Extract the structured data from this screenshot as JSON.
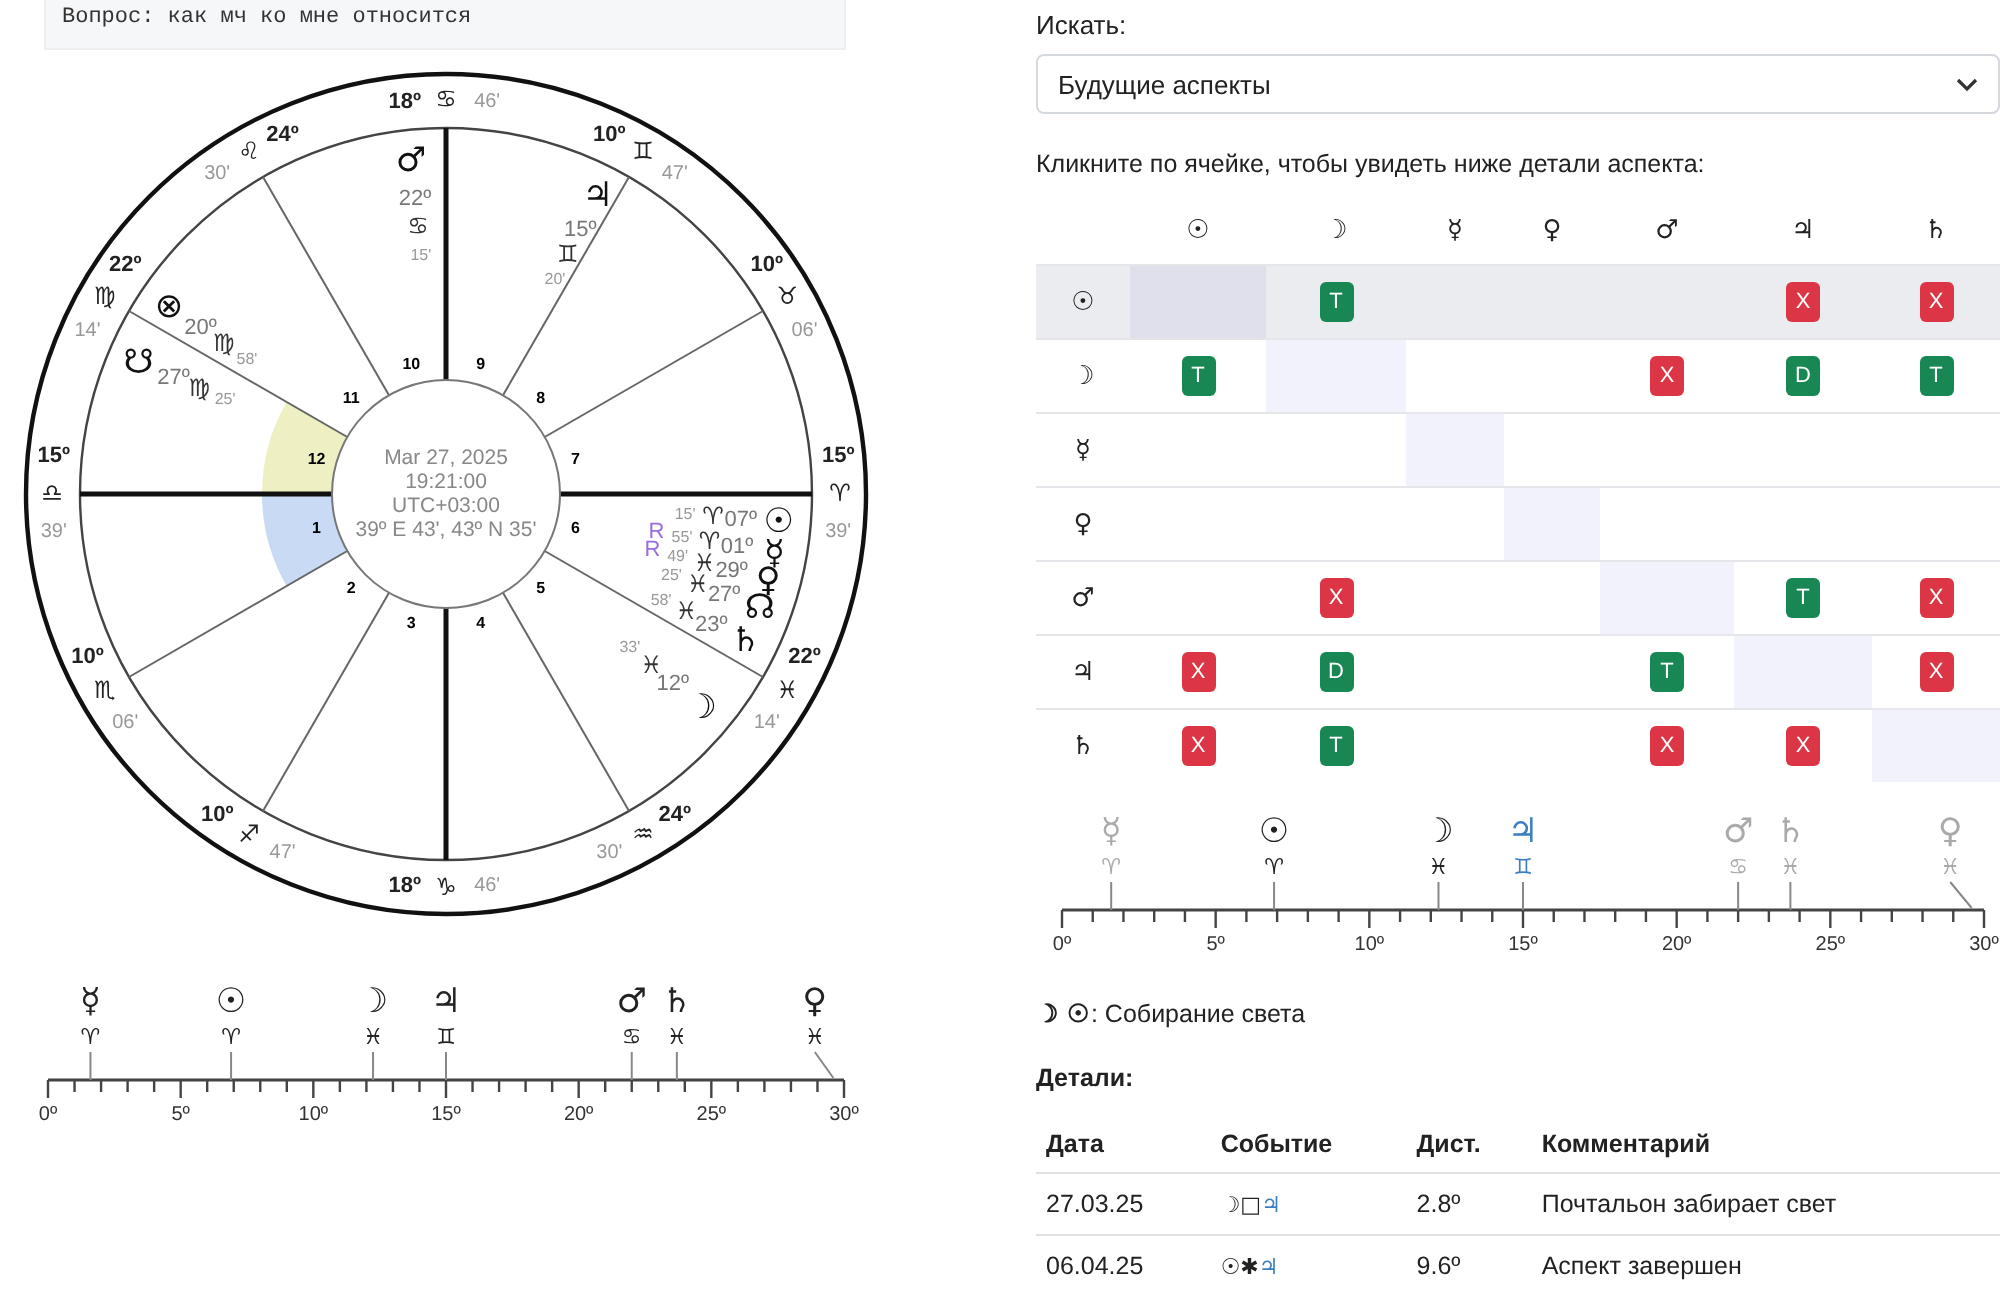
{
  "question": "Вопрос: как мч ко мне относится",
  "wheel": {
    "center": [
      "Mar 27, 2025",
      "19:21:00",
      "UTC+03:00",
      "39º E 43', 43º N 35'"
    ],
    "houses": [
      {
        "number": "10",
        "degree": "18º",
        "sign": "♋",
        "minutes": "46'"
      },
      {
        "number": "11",
        "degree": "24º",
        "sign": "♌",
        "minutes": "30'"
      },
      {
        "number": "9",
        "degree": "10º",
        "sign": "♊",
        "minutes": "47'"
      },
      {
        "number": "12",
        "degree": "22º",
        "sign": "♍",
        "minutes": "14'",
        "color": "#eef0c4"
      },
      {
        "number": "8",
        "degree": "10º",
        "sign": "♉",
        "minutes": "06'"
      },
      {
        "number": "1",
        "degree": "15º",
        "sign": "♎",
        "minutes": "39'",
        "color": "#c8daf4"
      },
      {
        "number": "7",
        "degree": "15º",
        "sign": "♈",
        "minutes": "39'"
      },
      {
        "number": "2",
        "degree": "10º",
        "sign": "♏",
        "minutes": "06'"
      },
      {
        "number": "6",
        "degree": "22º",
        "sign": "♓",
        "minutes": "14'"
      },
      {
        "number": "3",
        "degree": "10º",
        "sign": "♐",
        "minutes": "47'"
      },
      {
        "number": "5",
        "degree": "24º",
        "sign": "♒",
        "minutes": "30'"
      },
      {
        "number": "4",
        "degree": "18º",
        "sign": "♑",
        "minutes": "46'"
      }
    ],
    "planets": [
      {
        "glyph": "♂",
        "degree": "22º",
        "sign": "♋",
        "minutes": "15'"
      },
      {
        "glyph": "♃",
        "degree": "15º",
        "sign": "♊",
        "minutes": "20'"
      },
      {
        "glyph": "⊗",
        "degree": "20º",
        "sign": "♍",
        "minutes": "58'"
      },
      {
        "glyph": "☋",
        "degree": "27º",
        "sign": "♍",
        "minutes": "25'"
      },
      {
        "glyph": "☉",
        "degree": "07º",
        "sign": "♈",
        "minutes": "15'"
      },
      {
        "glyph": "☿",
        "degree": "01º",
        "sign": "♈",
        "minutes": "55'",
        "retrograde": "R"
      },
      {
        "glyph": "♀",
        "degree": "29º",
        "sign": "♓",
        "minutes": "49'",
        "retrograde": "R"
      },
      {
        "glyph": "☊",
        "degree": "27º",
        "sign": "♓",
        "minutes": "25'"
      },
      {
        "glyph": "♄",
        "degree": "23º",
        "sign": "♓",
        "minutes": "58'"
      },
      {
        "glyph": "☽",
        "degree": "12º",
        "sign": "♓",
        "minutes": "33'"
      }
    ]
  },
  "wheel_scale": {
    "ticks": [
      "0º",
      "5º",
      "10º",
      "15º",
      "20º",
      "25º",
      "30º"
    ],
    "markers": [
      {
        "glyph": "☿",
        "sign": "♈"
      },
      {
        "glyph": "☉",
        "sign": "♈"
      },
      {
        "glyph": "☽",
        "sign": "♓"
      },
      {
        "glyph": "♃",
        "sign": "♊"
      },
      {
        "glyph": "♂",
        "sign": "♋"
      },
      {
        "glyph": "♄",
        "sign": "♓"
      },
      {
        "glyph": "♀",
        "sign": "♓"
      }
    ]
  },
  "search": {
    "label": "Искать:",
    "value": "Будущие аспекты"
  },
  "hint": "Кликните по ячейке, чтобы увидеть ниже детали аспекта:",
  "grid": {
    "columns": [
      "☉",
      "☽",
      "☿",
      "♀",
      "♂",
      "♃",
      "♄"
    ],
    "rows": [
      {
        "planet": "☉",
        "selected": true,
        "cells": [
          null,
          {
            "text": "T",
            "color": "#198754"
          },
          null,
          null,
          null,
          {
            "text": "X",
            "color": "#dc3545"
          },
          {
            "text": "X",
            "color": "#dc3545"
          }
        ]
      },
      {
        "planet": "☽",
        "selected": false,
        "cells": [
          {
            "text": "T",
            "color": "#198754"
          },
          null,
          null,
          null,
          {
            "text": "X",
            "color": "#dc3545"
          },
          {
            "text": "D",
            "color": "#198754"
          },
          {
            "text": "T",
            "color": "#198754"
          }
        ]
      },
      {
        "planet": "☿",
        "selected": false,
        "cells": [
          null,
          null,
          null,
          null,
          null,
          null,
          null
        ]
      },
      {
        "planet": "♀",
        "selected": false,
        "cells": [
          null,
          null,
          null,
          null,
          null,
          null,
          null
        ]
      },
      {
        "planet": "♂",
        "selected": false,
        "cells": [
          null,
          {
            "text": "X",
            "color": "#dc3545"
          },
          null,
          null,
          null,
          {
            "text": "T",
            "color": "#198754"
          },
          {
            "text": "X",
            "color": "#dc3545"
          }
        ]
      },
      {
        "planet": "♃",
        "selected": false,
        "cells": [
          {
            "text": "X",
            "color": "#dc3545"
          },
          {
            "text": "D",
            "color": "#198754"
          },
          null,
          null,
          {
            "text": "T",
            "color": "#198754"
          },
          null,
          {
            "text": "X",
            "color": "#dc3545"
          }
        ]
      },
      {
        "planet": "♄",
        "selected": false,
        "cells": [
          {
            "text": "X",
            "color": "#dc3545"
          },
          {
            "text": "T",
            "color": "#198754"
          },
          null,
          null,
          {
            "text": "X",
            "color": "#dc3545"
          },
          {
            "text": "X",
            "color": "#dc3545"
          },
          null
        ]
      }
    ]
  },
  "transit_scale": {
    "ticks": [
      "0º",
      "5º",
      "10º",
      "15º",
      "20º",
      "25º",
      "30º"
    ],
    "markers": [
      {
        "glyph": "☿",
        "sign": "♈",
        "color": "#aaaaaa"
      },
      {
        "glyph": "☉",
        "sign": "♈",
        "color": "#222222"
      },
      {
        "glyph": "☽",
        "sign": "♓",
        "color": "#222222"
      },
      {
        "glyph": "♃",
        "sign": "♊",
        "color": "#3c7fc0"
      },
      {
        "glyph": "♂",
        "sign": "♋",
        "color": "#aaaaaa"
      },
      {
        "glyph": "♄",
        "sign": "♓",
        "color": "#aaaaaa"
      },
      {
        "glyph": "♀",
        "sign": "♓",
        "color": "#aaaaaa"
      }
    ]
  },
  "aspect_title": "**☽ ☉**: Собирание света",
  "details": {
    "title": "Детали:",
    "columns": [
      "Дата",
      "Событие",
      "Дист.",
      "Комментарий"
    ],
    "rows": [
      {
        "date": "27.03.25",
        "event": [
          "☽□",
          "♃"
        ],
        "distance": "2.8º",
        "comment": "Почтальон забирает свет"
      },
      {
        "date": "06.04.25",
        "event": [
          "☉✱",
          "♃"
        ],
        "distance": "9.6º",
        "comment": "Аспект завершен"
      }
    ]
  }
}
